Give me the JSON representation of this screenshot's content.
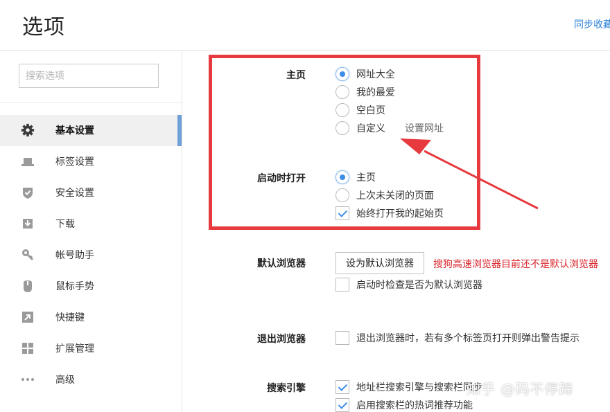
{
  "header": {
    "title": "选项",
    "sync_link": "同步收藏"
  },
  "sidebar": {
    "search_placeholder": "搜索选项",
    "items": [
      {
        "label": "基本设置",
        "icon": "gear-icon",
        "active": true
      },
      {
        "label": "标签设置",
        "icon": "tab-icon",
        "active": false
      },
      {
        "label": "安全设置",
        "icon": "shield-check-icon",
        "active": false
      },
      {
        "label": "下载",
        "icon": "download-icon",
        "active": false
      },
      {
        "label": "帐号助手",
        "icon": "key-icon",
        "active": false
      },
      {
        "label": "鼠标手势",
        "icon": "mouse-icon",
        "active": false
      },
      {
        "label": "快捷键",
        "icon": "shortcut-arrow-icon",
        "active": false
      },
      {
        "label": "扩展管理",
        "icon": "grid-icon",
        "active": false
      },
      {
        "label": "高级",
        "icon": "more-icon",
        "active": false
      }
    ]
  },
  "homepage": {
    "label": "主页",
    "options": [
      {
        "label": "网址大全",
        "selected": true
      },
      {
        "label": "我的最爱",
        "selected": false
      },
      {
        "label": "空白页",
        "selected": false
      },
      {
        "label": "自定义",
        "selected": false
      }
    ],
    "set_url_link": "设置网址"
  },
  "startup": {
    "label": "启动时打开",
    "options": [
      {
        "label": "主页",
        "selected": true
      },
      {
        "label": "上次未关闭的页面",
        "selected": false
      }
    ],
    "always_open_start": {
      "label": "始终打开我的起始页",
      "checked": true
    }
  },
  "default_browser": {
    "label": "默认浏览器",
    "button": "设为默认浏览器",
    "warning": "搜狗高速浏览器目前还不是默认浏览器",
    "check_on_start": {
      "label": "启动时检查是否为默认浏览器",
      "checked": false
    }
  },
  "exit_browser": {
    "label": "退出浏览器",
    "warn_multi_tabs": {
      "label": "退出浏览器时，若有多个标签页打开则弹出警告提示",
      "checked": false
    }
  },
  "search_engine": {
    "label": "搜索引擎",
    "address_bar_sync": {
      "label": "地址栏搜索引擎与搜索栏同步",
      "checked": true
    },
    "hot_words": {
      "label": "启用搜索栏的热词推荐功能",
      "checked": true
    }
  },
  "watermark": "知乎 @码不停蹄",
  "colors": {
    "accent": "#3c8ee8",
    "annotation_red": "#e63a3f",
    "warning": "#d9262c",
    "active_bar": "#6f9fd8"
  }
}
